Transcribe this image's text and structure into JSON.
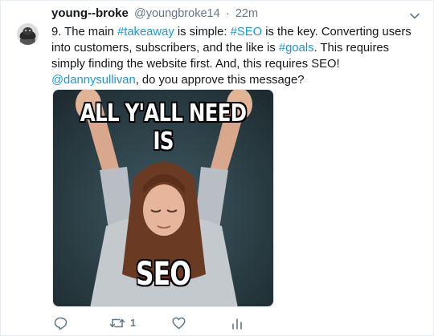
{
  "tweet": {
    "fullname": "young--broke",
    "handle": "@youngbroke14",
    "separator": "·",
    "time": "22m",
    "text_parts": [
      {
        "text": "9. The main ",
        "link": false
      },
      {
        "text": "#takeaway",
        "link": true
      },
      {
        "text": " is simple: ",
        "link": false
      },
      {
        "text": "#SEO",
        "link": true
      },
      {
        "text": " is the key. Converting users into customers, subscribers, and the like is ",
        "link": false
      },
      {
        "text": "#goals",
        "link": true
      },
      {
        "text": ". This requires simply finding the website first. And, this requires SEO! ",
        "link": false
      },
      {
        "text": "@dannysullivan",
        "link": true
      },
      {
        "text": ", do you approve this message?",
        "link": false
      }
    ],
    "meme": {
      "top_text": "ALL Y'ALL NEED IS",
      "bottom_text": "SEO"
    },
    "actions": {
      "reply_icon": "reply-icon",
      "retweet_icon": "retweet-icon",
      "retweet_count": "1",
      "like_icon": "heart-icon",
      "analytics_icon": "analytics-icon"
    }
  },
  "colors": {
    "link": "#1b95e0",
    "muted": "#657786",
    "text": "#14171a"
  }
}
